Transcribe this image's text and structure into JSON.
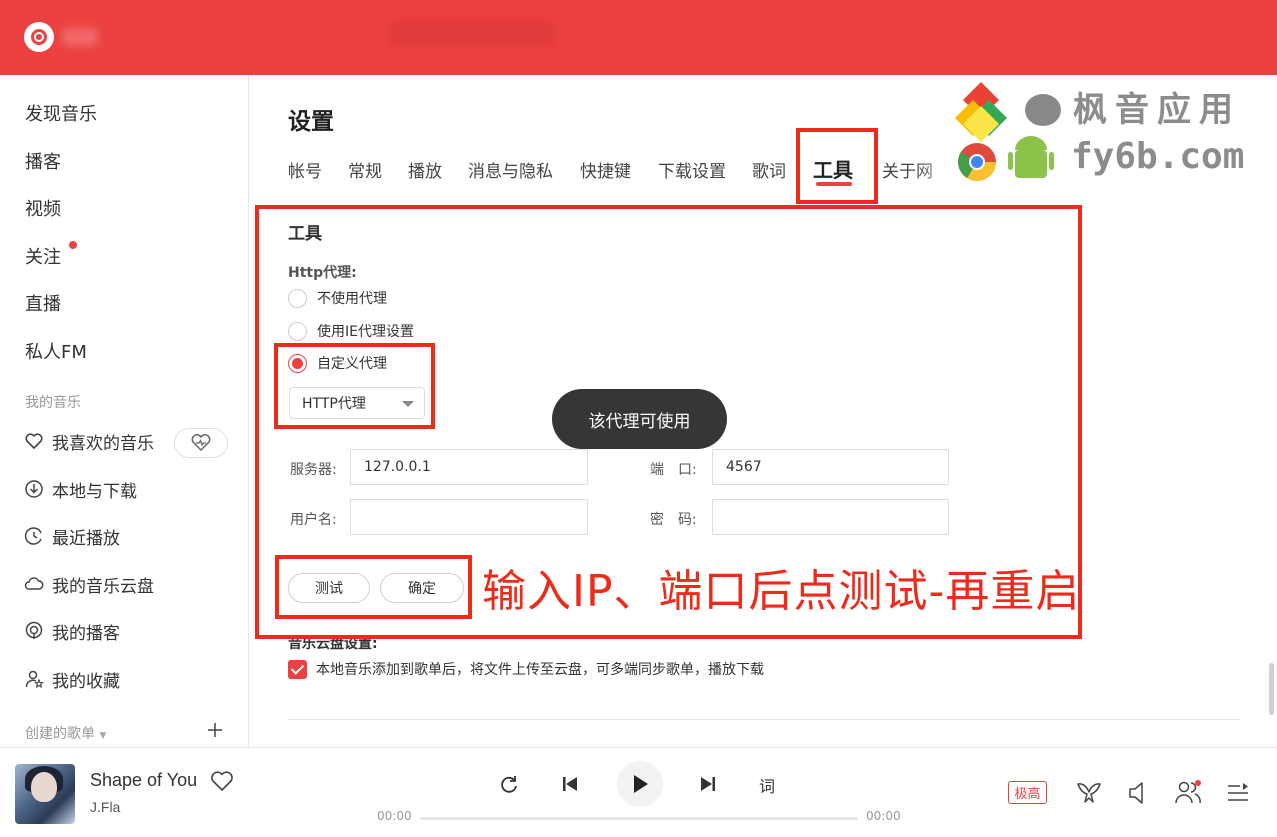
{
  "sidebar": {
    "nav": [
      "发现音乐",
      "播客",
      "视频",
      "关注",
      "直播",
      "私人FM"
    ],
    "my_music_title": "我的音乐",
    "my_music": [
      "我喜欢的音乐",
      "本地与下载",
      "最近播放",
      "我的音乐云盘",
      "我的播客",
      "我的收藏"
    ],
    "created_playlists_title": "创建的歌单"
  },
  "settings": {
    "title": "设置",
    "tabs": [
      "帐号",
      "常规",
      "播放",
      "消息与隐私",
      "快捷键",
      "下载设置",
      "歌词",
      "工具",
      "关于网"
    ],
    "active_tab": "工具",
    "section_title": "工具",
    "proxy": {
      "label": "Http代理:",
      "options": [
        "不使用代理",
        "使用IE代理设置",
        "自定义代理"
      ],
      "selected": "自定义代理",
      "type_select": "HTTP代理",
      "server_label": "服务器:",
      "server_value": "127.0.0.1",
      "port_label": "端　口:",
      "port_value": "4567",
      "username_label": "用户名:",
      "username_value": "",
      "password_label": "密　码:",
      "password_value": "",
      "test_button": "测试",
      "ok_button": "确定"
    },
    "toast": "该代理可使用",
    "cloud": {
      "label": "音乐云盘设置:",
      "checkbox_text": "本地音乐添加到歌单后，将文件上传至云盘，可多端同步歌单，播放下载",
      "checked": true
    }
  },
  "annotation": {
    "text": "输入IP、端口后点测试-再重启",
    "color": "#ee2a1b"
  },
  "watermark": {
    "line1": "枫音应用",
    "line2": "fy6b.com"
  },
  "player": {
    "song": "Shape of You",
    "artist": "J.Fla",
    "elapsed": "00:00",
    "duration": "00:00",
    "lyrics_button": "词",
    "quality": "极高"
  },
  "colors": {
    "brand": "#ec4141",
    "annotation": "#ee2a1b"
  }
}
